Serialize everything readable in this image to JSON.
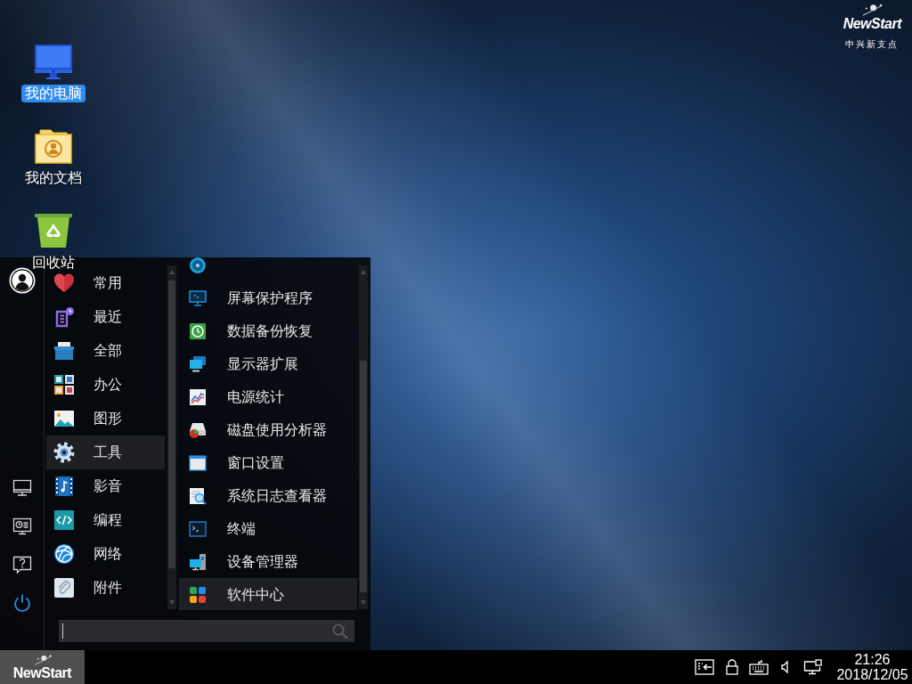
{
  "desktop_icons": [
    {
      "label": "我的电脑",
      "kind": "computer",
      "selected": true
    },
    {
      "label": "我的文档",
      "kind": "documents",
      "selected": false
    },
    {
      "label": "回收站",
      "kind": "trash",
      "selected": false
    }
  ],
  "brand": {
    "name": "NewStart",
    "subtitle": "中兴新支点"
  },
  "start_menu": {
    "categories": [
      {
        "label": "常用",
        "kind": "favorites",
        "selected": false
      },
      {
        "label": "最近",
        "kind": "recent",
        "selected": false
      },
      {
        "label": "全部",
        "kind": "all",
        "selected": false
      },
      {
        "label": "办公",
        "kind": "office",
        "selected": false
      },
      {
        "label": "图形",
        "kind": "graphics",
        "selected": false
      },
      {
        "label": "工具",
        "kind": "tools",
        "selected": true
      },
      {
        "label": "影音",
        "kind": "media",
        "selected": false
      },
      {
        "label": "编程",
        "kind": "programming",
        "selected": false
      },
      {
        "label": "网络",
        "kind": "network",
        "selected": false
      },
      {
        "label": "附件",
        "kind": "accessories",
        "selected": false
      }
    ],
    "apps": [
      {
        "kind": "partition",
        "selected": false
      },
      {
        "label": "屏幕保护程序",
        "kind": "screensaver",
        "selected": false
      },
      {
        "label": "数据备份恢复",
        "kind": "backup",
        "selected": false
      },
      {
        "label": "显示器扩展",
        "kind": "display",
        "selected": false
      },
      {
        "label": "电源统计",
        "kind": "power-stats",
        "selected": false
      },
      {
        "label": "磁盘使用分析器",
        "kind": "disk-usage",
        "selected": false
      },
      {
        "label": "窗口设置",
        "kind": "window-settings",
        "selected": false
      },
      {
        "label": "系统日志查看器",
        "kind": "log-viewer",
        "selected": false
      },
      {
        "label": "终端",
        "kind": "terminal",
        "selected": false
      },
      {
        "label": "设备管理器",
        "kind": "device-manager",
        "selected": false
      },
      {
        "label": "软件中心",
        "kind": "software-center",
        "selected": true
      }
    ],
    "search": {
      "focused": true
    }
  },
  "taskbar": {
    "start_button": "NewStart",
    "clock": {
      "time": "21:26",
      "date": "2018/12/05"
    }
  }
}
